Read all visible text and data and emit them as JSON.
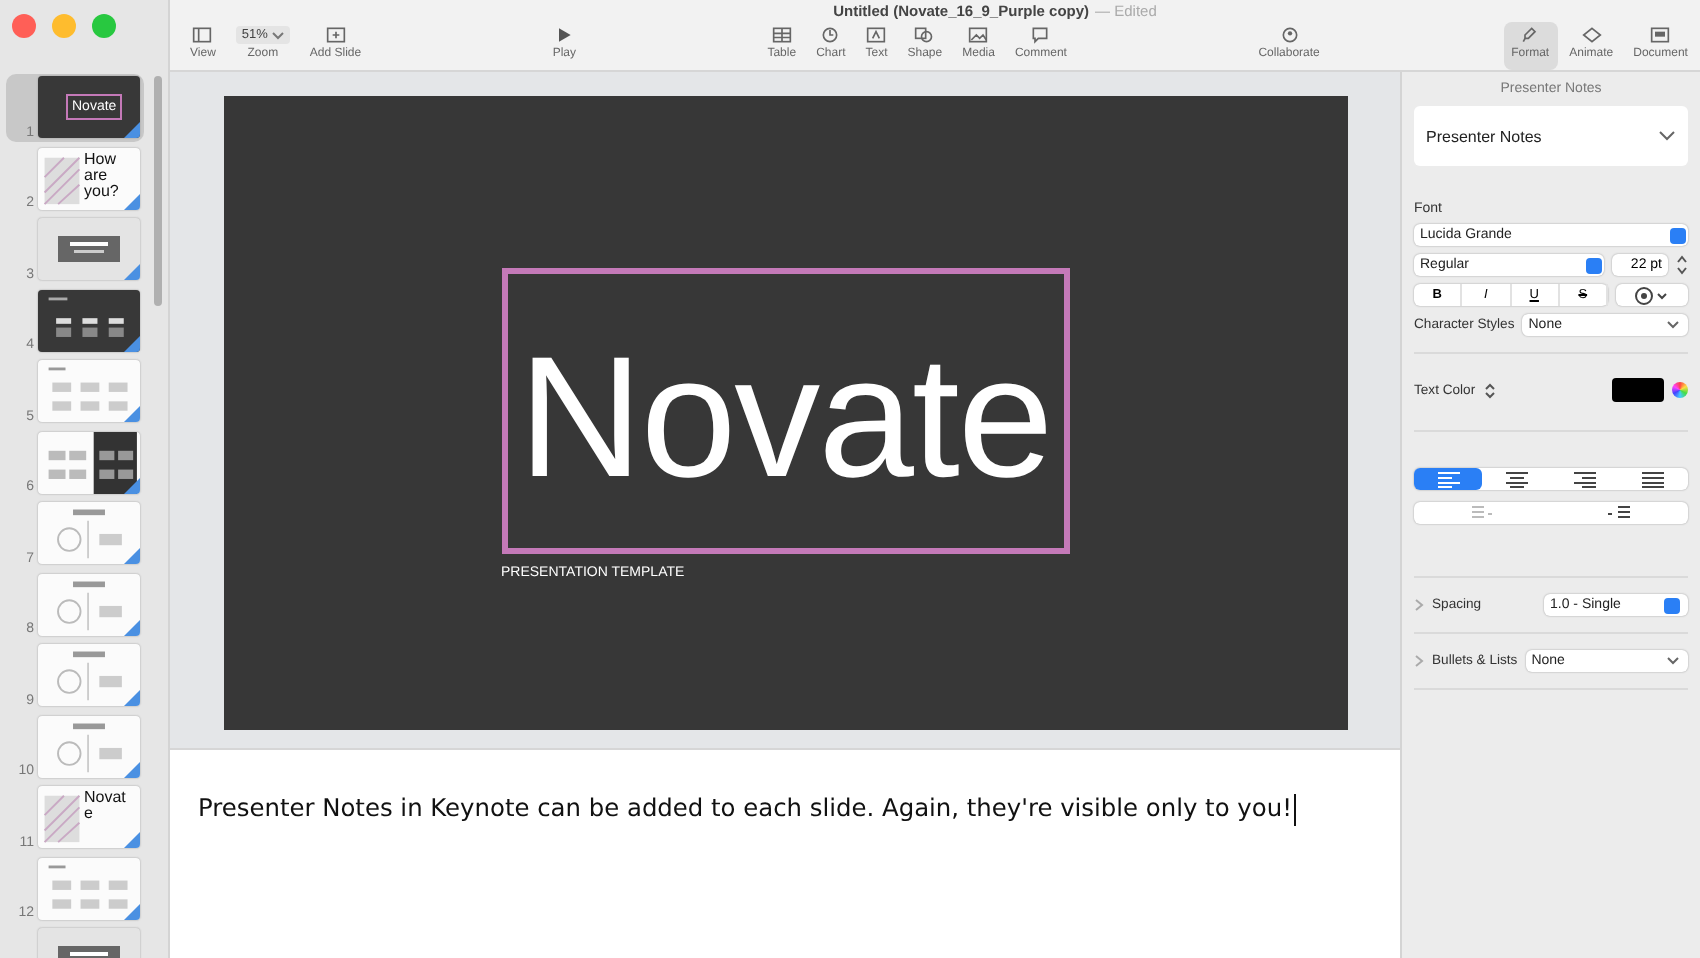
{
  "window": {
    "title": "Untitled (Novate_16_9_Purple copy)",
    "status": "— Edited"
  },
  "toolbar": {
    "groups": [
      [
        {
          "label": "View",
          "selected": false
        },
        {
          "label": "Zoom",
          "value": "51%",
          "selected": false
        },
        {
          "label": "Add Slide",
          "selected": false
        }
      ],
      [
        {
          "label": "Play",
          "selected": false
        }
      ],
      [
        {
          "label": "Table",
          "selected": false
        },
        {
          "label": "Chart",
          "selected": false
        },
        {
          "label": "Text",
          "selected": false
        },
        {
          "label": "Shape",
          "selected": false
        },
        {
          "label": "Media",
          "selected": false
        },
        {
          "label": "Comment",
          "selected": false
        }
      ],
      [
        {
          "label": "Collaborate",
          "selected": false
        }
      ],
      [
        {
          "label": "Format",
          "selected": true
        },
        {
          "label": "Animate",
          "selected": false
        },
        {
          "label": "Document",
          "selected": false
        }
      ]
    ]
  },
  "slides": [
    {
      "number": "1",
      "kind": "title",
      "title": "Novate",
      "selected": true
    },
    {
      "number": "2",
      "kind": "greeting",
      "title": "How are you?",
      "selected": false
    },
    {
      "number": "3",
      "kind": "banner",
      "selected": false
    },
    {
      "number": "4",
      "kind": "dark",
      "selected": false
    },
    {
      "number": "5",
      "kind": "light",
      "selected": false
    },
    {
      "number": "6",
      "kind": "split",
      "selected": false
    },
    {
      "number": "7",
      "kind": "diagram",
      "selected": false
    },
    {
      "number": "8",
      "kind": "diagram",
      "selected": false
    },
    {
      "number": "9",
      "kind": "diagram",
      "selected": false
    },
    {
      "number": "10",
      "kind": "diagram",
      "selected": false
    },
    {
      "number": "11",
      "kind": "greeting",
      "title": "Novat e",
      "selected": false
    },
    {
      "number": "12",
      "kind": "light",
      "selected": false
    },
    {
      "kind": "banner",
      "selected": false
    }
  ],
  "slide": {
    "title": "Novate",
    "subtitle": "PRESENTATION TEMPLATE"
  },
  "notes": {
    "text": "Presenter Notes in Keynote can be added to each slide. Again, they're visible only to you!"
  },
  "inspector": {
    "header": "Presenter Notes",
    "style": "Presenter Notes",
    "font_label": "Font",
    "font": "Lucida Grande",
    "typeface": "Regular",
    "size": "22 pt",
    "styles": [
      {
        "label": "B",
        "selected": false
      },
      {
        "label": "I",
        "selected": false
      },
      {
        "label": "U",
        "selected": false
      },
      {
        "label": "S",
        "selected": false
      }
    ],
    "character_styles_label": "Character Styles",
    "character_style": "None",
    "text_color_label": "Text Color",
    "alignments": [
      {
        "selected": true
      },
      {
        "selected": false
      },
      {
        "selected": false
      },
      {
        "selected": false
      }
    ],
    "spacing_label": "Spacing",
    "spacing": "1.0 - Single",
    "bullets_label": "Bullets & Lists",
    "bullets": "None"
  }
}
